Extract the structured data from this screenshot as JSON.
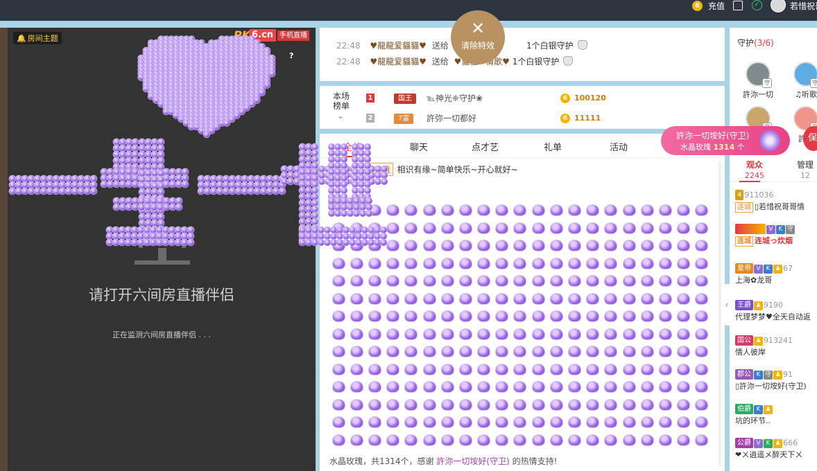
{
  "topbar": {
    "coin_glyph": "6",
    "recharge_label": "充值",
    "edit_icon": "edit-icon",
    "check_icon": "check-circle-icon",
    "check_glyph": "✓",
    "username": "若惜祝哥"
  },
  "video": {
    "room_topic_icon": "🔔",
    "room_topic": "房间主题",
    "logo_pk": "PK",
    "logo_site": "6.cn",
    "logo_mobile": "手机直播",
    "help_glyph": "?",
    "open_tip": "请打开六间房直播伴侣",
    "detect_tip": "正在监测六间房直播伴侣 . . ."
  },
  "effect": {
    "text": "一生一世",
    "color": "#a97cf0"
  },
  "clear_effects": {
    "glyph": "✕",
    "label": "清除特效"
  },
  "notices": [
    {
      "time": "22:48",
      "sender": "♥龍龍爱貓貓♥",
      "verb": "送给",
      "target": "♥",
      "gift": "1个白银守护"
    },
    {
      "time": "22:48",
      "sender": "♥龍龍爱貓貓♥",
      "verb": "送给",
      "target": "♥貓貓♥情歌♥",
      "gift": "1个白银守护"
    }
  ],
  "rank": {
    "title_line1": "本场",
    "title_line2": "榜单",
    "chevron": "⌄",
    "rows": [
      {
        "no": "1",
        "badge": "国王",
        "badge_color": "#c0392b",
        "name": "℡神光❈守护❀",
        "coin": "6",
        "score": "100120"
      },
      {
        "no": "2",
        "badge": "7富",
        "badge_color": "#e8883a",
        "name": "許弥一切都好",
        "coin": "6",
        "score": "11111"
      }
    ]
  },
  "chat": {
    "tabs": [
      "全部",
      "聊天",
      "点才艺",
      "礼单",
      "活动"
    ],
    "welcome_prefix": "欢迎 :",
    "welcome_tag": "代理充值",
    "welcome_text": "相识有缘~简单快乐~开心就好~",
    "gift_rows": 14,
    "gift_cols": 21,
    "thanks_prefix": "水晶玫瑰，共1314个，感谢",
    "thanks_user": "許沵一切垵好(守卫)",
    "thanks_suffix": "的热情支持!"
  },
  "popup": {
    "user": "許沵一切垵好(守卫)",
    "gift": "水晶玫瑰",
    "count": "1314",
    "unit": "个"
  },
  "protect_label": "保",
  "guards": {
    "title": "守护",
    "count": "(3/6)",
    "items": [
      {
        "name": "許沵一切",
        "shield": "守",
        "color": "#7f8c8d"
      },
      {
        "name": "♫听歌",
        "shield": "守",
        "color": "#5dade2"
      },
      {
        "name": "",
        "shield": "守",
        "color": "#c9a66b"
      },
      {
        "name": "許沵",
        "shield": "守",
        "color": "#f1948a"
      }
    ]
  },
  "audience_tabs": {
    "audience_label": "观众",
    "audience_count": "2245",
    "admin_label": "管理",
    "admin_count": "12"
  },
  "collapse_glyph": "‹",
  "audience": [
    {
      "level": "4",
      "id": "911036",
      "lc": "连城",
      "name": "▯若惜祝哥哥情",
      "red": false
    },
    {
      "level": "V K 守",
      "id": "",
      "lc": "连城",
      "name": "连城っ炊烟",
      "red": true
    },
    {
      "level": "皇帝",
      "id": "67",
      "lc": "",
      "name": "上海✿龙哥",
      "red": false
    },
    {
      "level": "王爵",
      "id": "9190",
      "lc": "",
      "name": "代理梦梦♥全天自动返",
      "red": false
    },
    {
      "level": "国公",
      "id": "913241",
      "lc": "",
      "name": "情人彼岸",
      "red": false
    },
    {
      "level": "郡公",
      "id": "91",
      "lc": "",
      "name": "▯許沵一切垵好(守卫)",
      "red": false
    },
    {
      "level": "伯爵",
      "id": "",
      "lc": "",
      "name": "坑的环节..",
      "red": false
    },
    {
      "level": "公爵",
      "id": "666",
      "lc": "",
      "name": "❤ㄨ逍遥メ醉天下ㄨ",
      "red": false
    }
  ]
}
